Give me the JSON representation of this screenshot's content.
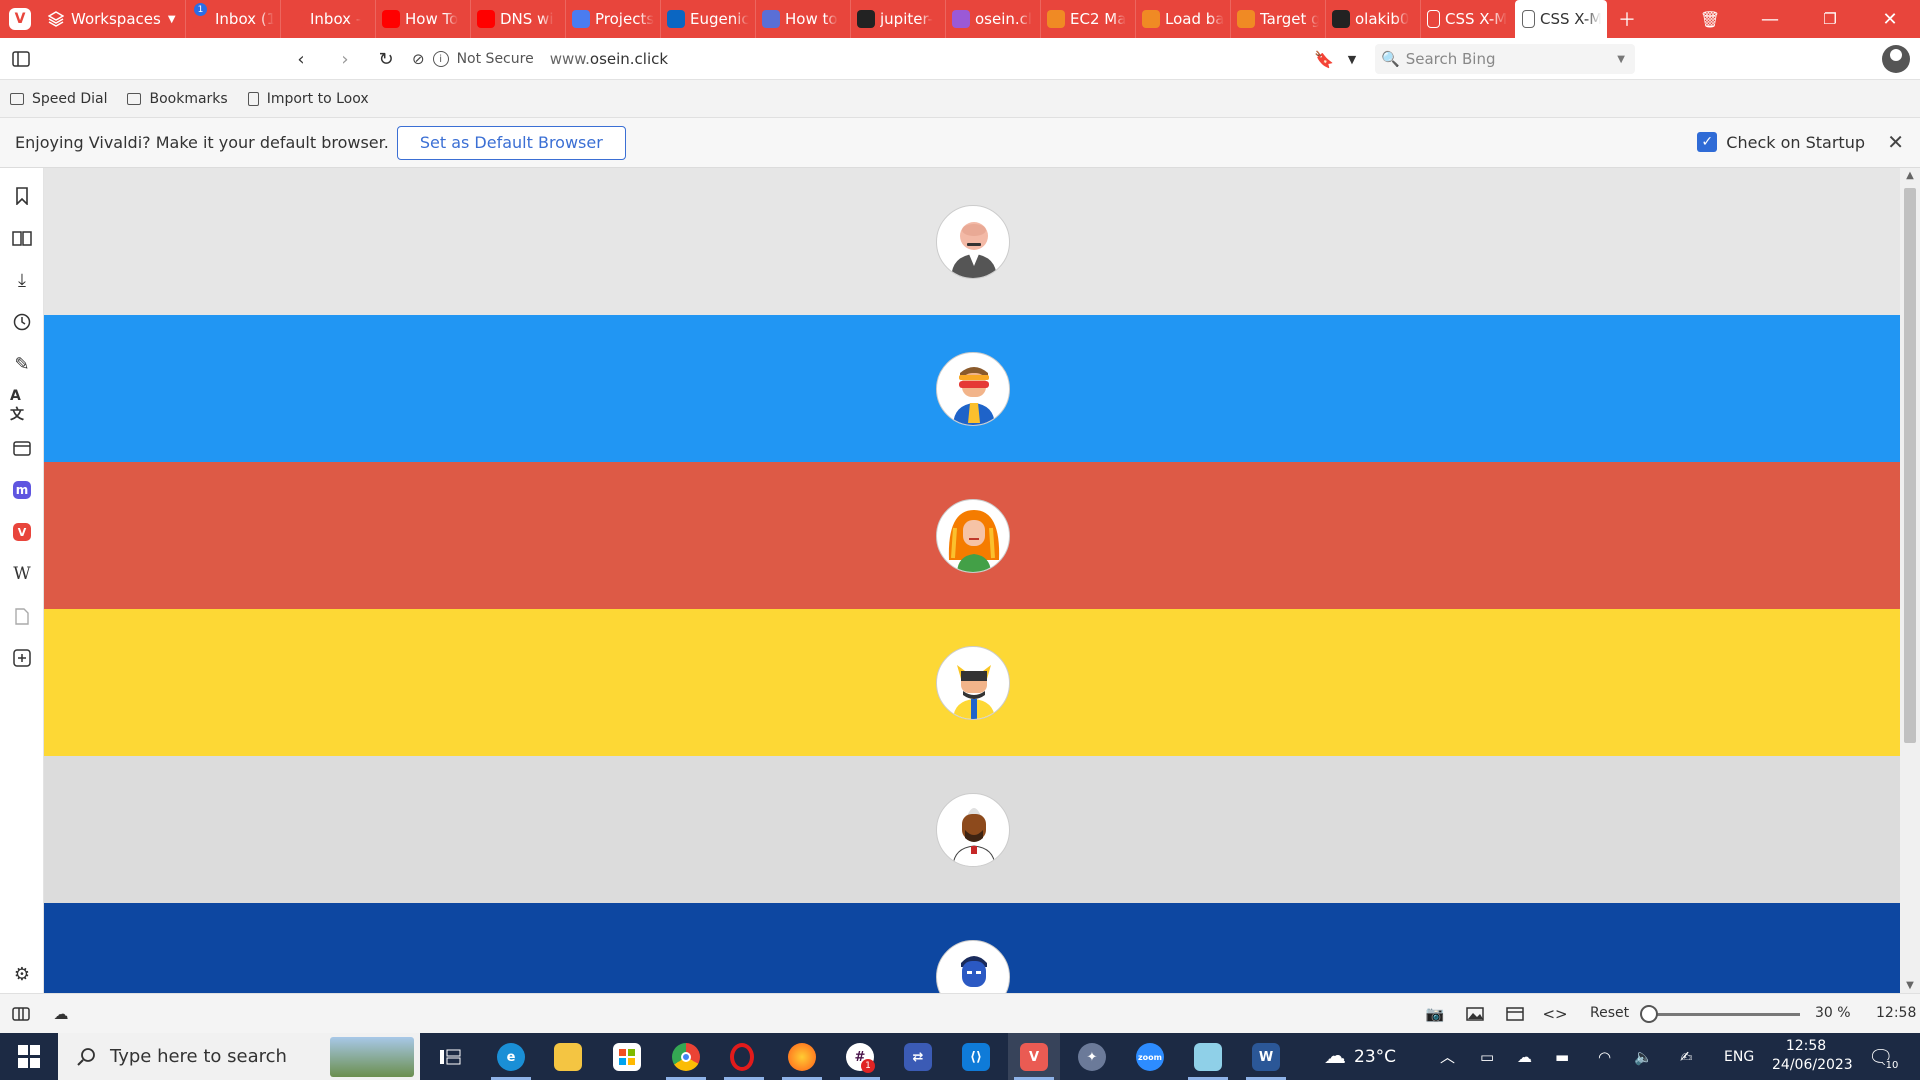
{
  "browser": {
    "workspaces_label": "Workspaces",
    "tabs": [
      {
        "label": "Inbox (1",
        "icon": "gmail-icon",
        "color": "#e8453c",
        "badge": "1"
      },
      {
        "label": "Inbox -",
        "icon": "gmail-icon",
        "color": "#e8453c"
      },
      {
        "label": "How To",
        "icon": "youtube-icon",
        "color": "#ff0000"
      },
      {
        "label": "DNS wi",
        "icon": "youtube-icon",
        "color": "#ff0000"
      },
      {
        "label": "Projects",
        "icon": "c-icon",
        "color": "#4a7cf0"
      },
      {
        "label": "Eugenic",
        "icon": "linkedin-icon",
        "color": "#0a66c2"
      },
      {
        "label": "How to",
        "icon": "cloud-icon",
        "color": "#5a6fd6"
      },
      {
        "label": "jupiter-",
        "icon": "github-icon",
        "color": "#222222"
      },
      {
        "label": "osein.cl",
        "icon": "extension-icon",
        "color": "#9b59d6"
      },
      {
        "label": "EC2 Ma",
        "icon": "aws-link-icon",
        "color": "#f08a24"
      },
      {
        "label": "Load ba",
        "icon": "aws-link-icon",
        "color": "#f08a24"
      },
      {
        "label": "Target g",
        "icon": "aws-link-icon",
        "color": "#f08a24"
      },
      {
        "label": "olakib0",
        "icon": "github-icon",
        "color": "#222222"
      },
      {
        "label": "CSS X-M",
        "icon": "page-icon",
        "color": "#ffffff"
      },
      {
        "label": "CSS X-M",
        "icon": "page-icon",
        "color": "#666666",
        "active": true
      }
    ],
    "address": {
      "not_secure": "Not Secure",
      "url_prefix": "www.",
      "url_domain": "osein.click",
      "search_placeholder": "Search Bing"
    },
    "bookmarks": [
      "Speed Dial",
      "Bookmarks",
      "Import to Loox"
    ],
    "notification": {
      "message": "Enjoying Vivaldi? Make it your default browser.",
      "button": "Set as Default Browser",
      "checkbox_label": "Check on Startup"
    },
    "status": {
      "reset": "Reset",
      "zoom": "30 %",
      "time": "12:58"
    }
  },
  "page": {
    "bands": [
      {
        "color": "#e6e6e6",
        "avatar": "bald-man-avatar"
      },
      {
        "color": "#2196f3",
        "avatar": "cyclops-avatar"
      },
      {
        "color": "#dd5a46",
        "avatar": "red-hair-woman-avatar"
      },
      {
        "color": "#fdd835",
        "avatar": "wolverine-avatar"
      },
      {
        "color": "#dcdcdc",
        "avatar": "mohawk-man-avatar"
      },
      {
        "color": "#0d47a1",
        "avatar": "blue-mutant-avatar"
      }
    ]
  },
  "taskbar": {
    "search_placeholder": "Type here to search",
    "weather": "23°C",
    "language": "ENG",
    "time": "12:58",
    "date": "24/06/2023",
    "notification_count": "10",
    "slack_badge": "1"
  }
}
